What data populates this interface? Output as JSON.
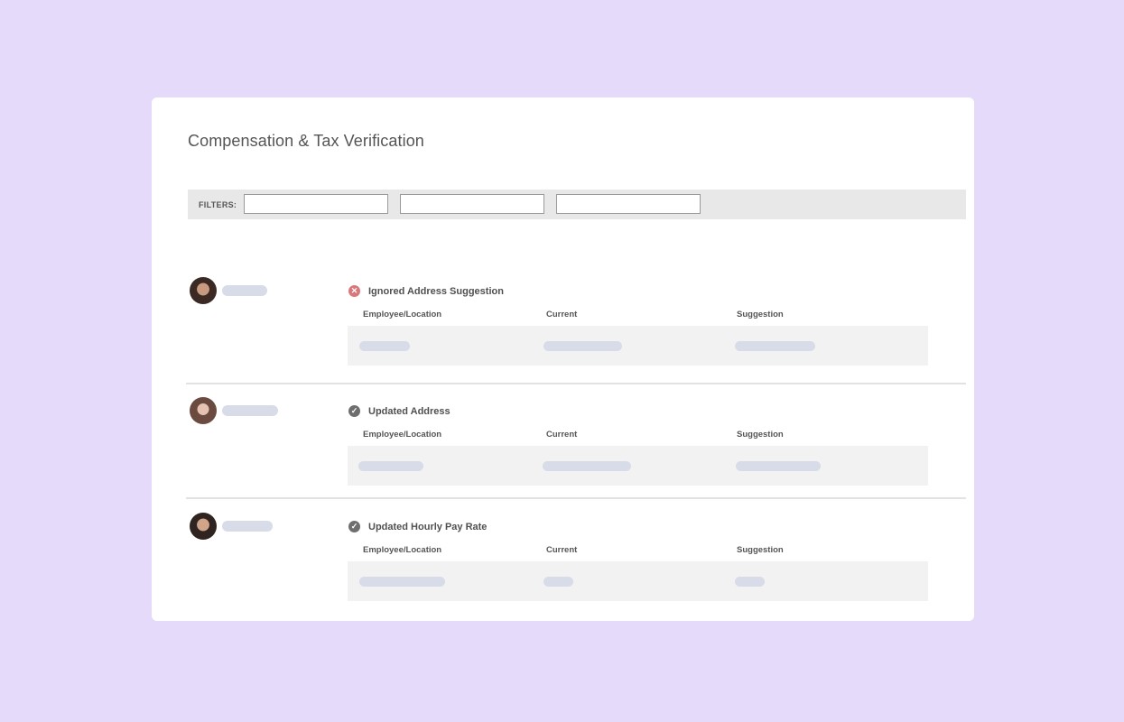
{
  "page": {
    "title": "Compensation & Tax Verification"
  },
  "filters": {
    "label": "FILTERS:",
    "inputs": [
      {
        "value": "",
        "placeholder": ""
      },
      {
        "value": "",
        "placeholder": ""
      },
      {
        "value": "",
        "placeholder": ""
      }
    ]
  },
  "columns": {
    "employee_location": "Employee/Location",
    "current": "Current",
    "suggestion": "Suggestion"
  },
  "records": [
    {
      "status": "Ignored Address Suggestion",
      "status_icon": "x-circle-icon",
      "status_color": "#d9777b"
    },
    {
      "status": "Updated Address",
      "status_icon": "check-circle-icon",
      "status_color": "#6e6e6e"
    },
    {
      "status": "Updated Hourly Pay Rate",
      "status_icon": "check-circle-icon",
      "status_color": "#6e6e6e"
    }
  ],
  "colors": {
    "background": "#e6dafa",
    "card": "#ffffff",
    "filter_bar": "#e8e8e8",
    "placeholder_pill": "#d7dce8",
    "data_block": "#f2f2f2"
  }
}
